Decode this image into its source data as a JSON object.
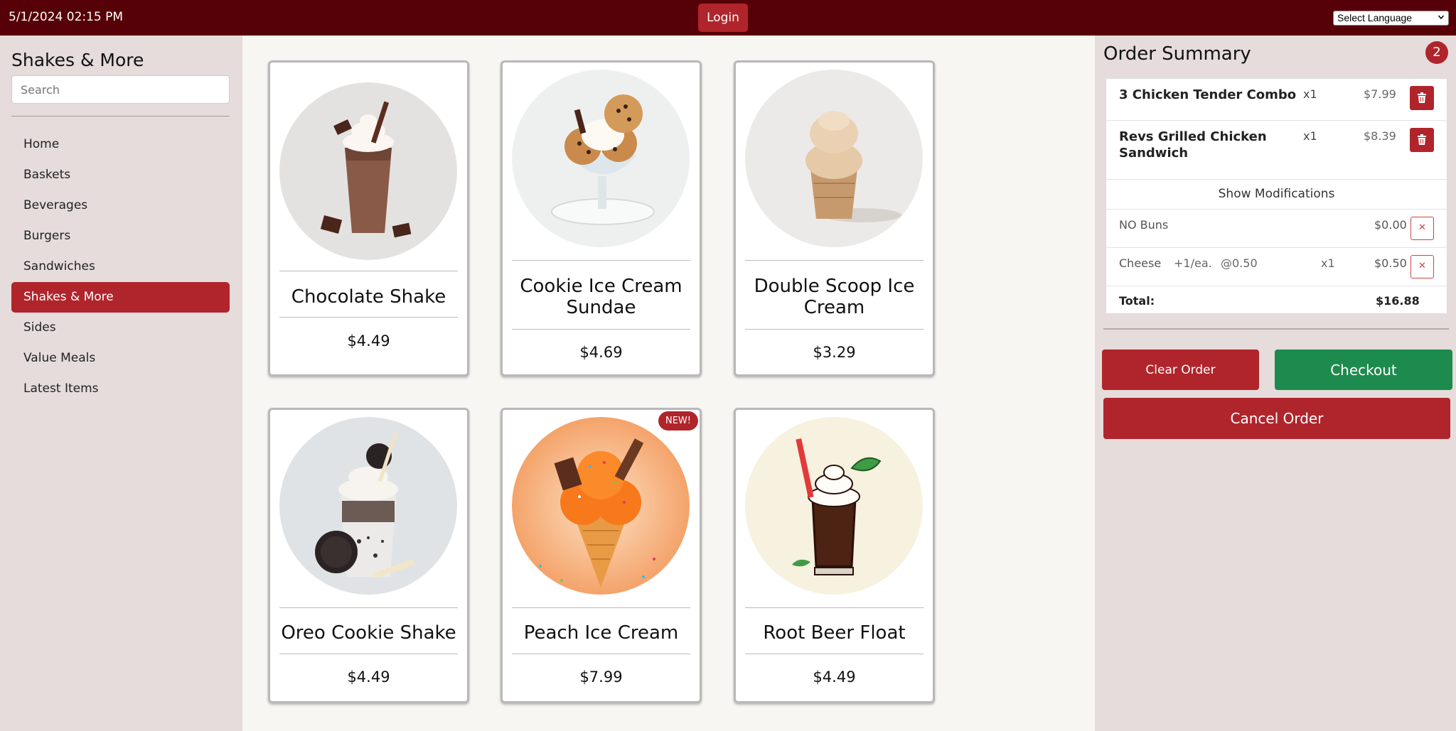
{
  "topbar": {
    "datetime": "5/1/2024 02:15 PM",
    "login_label": "Login",
    "language_select": "Select Language"
  },
  "sidebar": {
    "brand": "Shakes & More",
    "search_placeholder": "Search",
    "items": [
      {
        "label": "Home",
        "active": false
      },
      {
        "label": "Baskets",
        "active": false
      },
      {
        "label": "Beverages",
        "active": false
      },
      {
        "label": "Burgers",
        "active": false
      },
      {
        "label": "Sandwiches",
        "active": false
      },
      {
        "label": "Shakes & More",
        "active": true
      },
      {
        "label": "Sides",
        "active": false
      },
      {
        "label": "Value Meals",
        "active": false
      },
      {
        "label": "Latest Items",
        "active": false
      }
    ]
  },
  "menu": {
    "items": [
      {
        "name": "Chocolate Shake",
        "price": "$4.49",
        "icon": "chocolate-shake-image"
      },
      {
        "name": "Cookie Ice Cream Sundae",
        "price": "$4.69",
        "icon": "sundae-image"
      },
      {
        "name": "Double Scoop Ice Cream",
        "price": "$3.29",
        "icon": "ice-cream-cup-image"
      },
      {
        "name": "Oreo Cookie Shake",
        "price": "$4.49",
        "icon": "oreo-shake-image"
      },
      {
        "name": "Peach Ice Cream",
        "price": "$7.99",
        "icon": "peach-cone-image",
        "badge": "NEW!"
      },
      {
        "name": "Root Beer Float",
        "price": "$4.49",
        "icon": "root-beer-float-image"
      }
    ]
  },
  "order": {
    "title": "Order Summary",
    "count": "2",
    "items": [
      {
        "name": "3 Chicken Tender Combo",
        "qty": "x1",
        "price": "$7.99"
      },
      {
        "name": "Revs Grilled Chicken Sandwich",
        "qty": "x1",
        "price": "$8.39"
      }
    ],
    "show_mods_label": "Show Modifications",
    "modifications": [
      {
        "name": "NO Buns",
        "price": "$0.00"
      },
      {
        "name": "Cheese",
        "unit": "+1/ea.",
        "rate": "@0.50",
        "qty": "x1",
        "price": "$0.50"
      }
    ],
    "total_label": "Total:",
    "total_value": "$16.88",
    "clear_label": "Clear Order",
    "checkout_label": "Checkout",
    "cancel_label": "Cancel Order"
  },
  "colors": {
    "topbar": "#560007",
    "accent": "#b0252b",
    "checkout": "#1d8a4e",
    "sidebar_bg": "#e6dcdc"
  }
}
